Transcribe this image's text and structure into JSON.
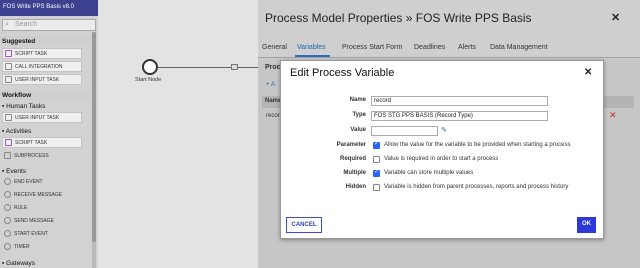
{
  "palette": {
    "title": "FOS Write PPS Basis v8.0",
    "search_placeholder": "Search",
    "sections": {
      "suggested": "Suggested",
      "workflow": "Workflow",
      "human_tasks": "Human Tasks",
      "activities": "Activities",
      "events": "Events",
      "gateways": "Gateways"
    },
    "suggested_items": [
      "SCRIPT TASK",
      "CALL INTEGRATION",
      "USER INPUT TASK"
    ],
    "human_items": [
      "USER INPUT TASK"
    ],
    "activity_items": [
      "SCRIPT TASK",
      "SUBPROCESS"
    ],
    "event_items": [
      "END EVENT",
      "RECEIVE MESSAGE",
      "RULE",
      "SEND MESSAGE",
      "START EVENT",
      "TIMER"
    ]
  },
  "canvas": {
    "start_node_label": "Start Node"
  },
  "properties": {
    "title": "Process Model Properties » FOS Write PPS Basis",
    "tabs": [
      "General",
      "Variables",
      "Process Start Form",
      "Deadlines",
      "Alerts",
      "Data Management"
    ],
    "active_tab": "Variables",
    "background": {
      "section_title": "Proce",
      "add_link": "+ A",
      "name_header": "Name",
      "row_text": "recor"
    }
  },
  "modal": {
    "title": "Edit Process Variable",
    "fields": {
      "name_label": "Name",
      "name_value": "record",
      "type_label": "Type",
      "type_value": "FOS STG PPS BASIS (Record Type)",
      "value_label": "Value",
      "value_value": ""
    },
    "checkboxes": [
      {
        "label": "Parameter",
        "text": "Allow the value for the variable to be provided when starting a process",
        "checked": true
      },
      {
        "label": "Required",
        "text": "Value is required in order to start a process",
        "checked": false
      },
      {
        "label": "Multiple",
        "text": "Variable can store multiple values",
        "checked": true
      },
      {
        "label": "Hidden",
        "text": "Variable is hidden from parent processes, reports and process history",
        "checked": false
      }
    ],
    "cancel_label": "CANCEL",
    "ok_label": "OK"
  },
  "colors": {
    "brand_bar": "#3d3f8f",
    "accent": "#2d38d9",
    "link": "#1565c0",
    "delete": "#c62828"
  }
}
